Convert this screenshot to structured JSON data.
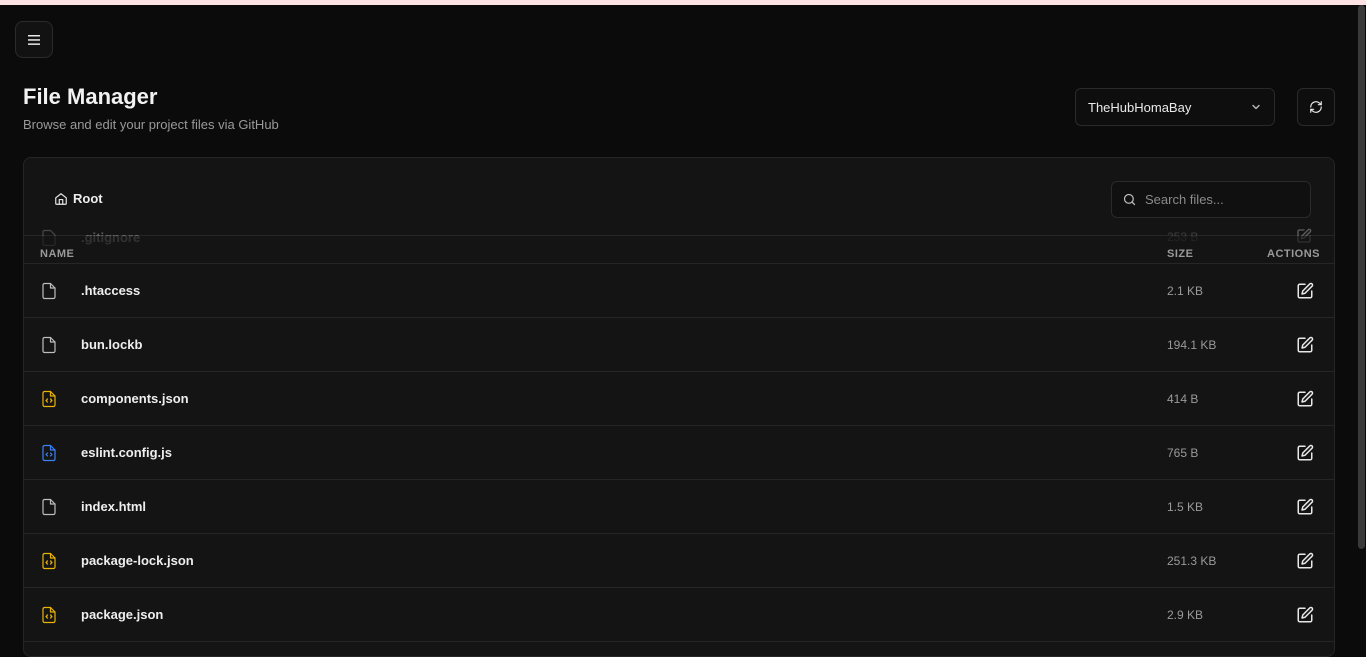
{
  "header": {
    "title": "File Manager",
    "subtitle": "Browse and edit your project files via GitHub"
  },
  "repo_selector": {
    "selected": "TheHubHomaBay"
  },
  "breadcrumb": {
    "root_label": "Root"
  },
  "search": {
    "placeholder": "Search files..."
  },
  "table": {
    "columns": {
      "name": "NAME",
      "size": "SIZE",
      "actions": "ACTIONS"
    },
    "partial_row": {
      "name": ".gitignore",
      "size": "253 B"
    },
    "rows": [
      {
        "name": ".htaccess",
        "size": "2.1 KB",
        "icon": "file-icon"
      },
      {
        "name": "bun.lockb",
        "size": "194.1 KB",
        "icon": "file-icon"
      },
      {
        "name": "components.json",
        "size": "414 B",
        "icon": "json-file-icon"
      },
      {
        "name": "eslint.config.js",
        "size": "765 B",
        "icon": "js-file-icon"
      },
      {
        "name": "index.html",
        "size": "1.5 KB",
        "icon": "file-icon"
      },
      {
        "name": "package-lock.json",
        "size": "251.3 KB",
        "icon": "json-file-icon"
      },
      {
        "name": "package.json",
        "size": "2.9 KB",
        "icon": "json-file-icon"
      }
    ]
  },
  "colors": {
    "background": "#0b0b0b",
    "card": "#141414",
    "json_icon": "#eab308",
    "js_icon": "#3b82f6",
    "top_strip": "#fde2e4"
  }
}
